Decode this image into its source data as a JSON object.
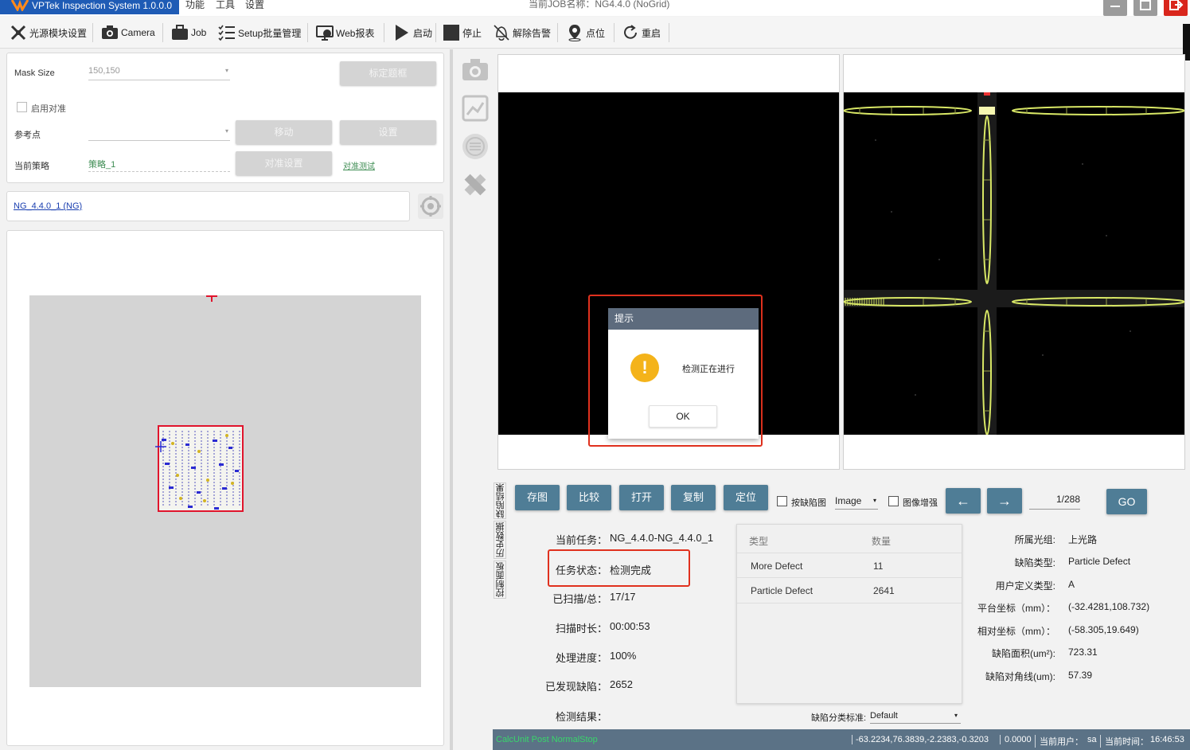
{
  "titlebar": {
    "app_title": "VPTek Inspection System 1.0.0.0",
    "menu": [
      "功能",
      "工具",
      "设置"
    ],
    "caption": "当前JOB名称：NG4.4.0 (NoGrid)"
  },
  "toolbar": {
    "items": [
      {
        "label": "光源模块设置",
        "icon": "light-module-icon"
      },
      {
        "label": "Camera",
        "icon": "camera-icon"
      },
      {
        "label": "Job",
        "icon": "briefcase-icon"
      },
      {
        "label": "Setup批量管理",
        "icon": "checklist-icon"
      },
      {
        "label": "Web报表",
        "icon": "monitor-icon"
      },
      {
        "label": "启动",
        "icon": "play-icon"
      },
      {
        "label": "停止",
        "icon": "stop-icon"
      },
      {
        "label": "解除告警",
        "icon": "bell-off-icon"
      },
      {
        "label": "点位",
        "icon": "location-pin-icon"
      },
      {
        "label": "重启",
        "icon": "restart-icon"
      }
    ]
  },
  "left_panel": {
    "mask_size_label": "Mask Size",
    "mask_size_value": "150,150",
    "calibrate_button": "标定题框",
    "enable_align_label": "启用对准",
    "ref_point_label": "参考点",
    "move_button": "移动",
    "set_button": "设置",
    "strategy_label": "当前策略",
    "strategy_value": "策略_1",
    "align_settings_button": "对准设置",
    "align_test_link": "对准测试",
    "job_link": "NG_4.4.0_1 (NG)"
  },
  "dialog": {
    "title": "提示",
    "message": "检测正在进行",
    "ok_label": "OK",
    "icon": "warning-icon"
  },
  "bottom_toolbar": {
    "save_image": "存图",
    "compare": "比较",
    "open": "打开",
    "copy": "复制",
    "locate": "定位",
    "by_defect_label": "按缺陷图",
    "image_select": "Image",
    "enhance_label": "图像增强",
    "prev_arrow": "←",
    "next_arrow": "→",
    "page": "1/288",
    "go_label": "GO"
  },
  "vertical_tabs": [
    "缺陷结果",
    "历史数据",
    "控制面板"
  ],
  "task_info": [
    {
      "label": "当前任务：",
      "value": "NG_4.4.0-NG_4.4.0_1"
    },
    {
      "label": "任务状态：",
      "value": "检测完成"
    },
    {
      "label": "已扫描/总：",
      "value": "17/17"
    },
    {
      "label": "扫描时长：",
      "value": "00:00:53"
    },
    {
      "label": "处理进度：",
      "value": "100%"
    },
    {
      "label": "已发现缺陷：",
      "value": "2652"
    },
    {
      "label": "检测结果：",
      "value": ""
    }
  ],
  "defect_table": {
    "headers": [
      "类型",
      "数量"
    ],
    "rows": [
      {
        "type": "More Defect",
        "count": "11"
      },
      {
        "type": "Particle Defect",
        "count": "2641"
      }
    ]
  },
  "classify_standard": {
    "label": "缺陷分类标准:",
    "value": "Default"
  },
  "defect_detail": [
    {
      "label": "所属光组:",
      "value": "上光路"
    },
    {
      "label": "缺陷类型:",
      "value": "Particle Defect"
    },
    {
      "label": "用户定义类型:",
      "value": "A"
    },
    {
      "label": "平台坐标（mm）：",
      "value": "(-32.4281,108.732)"
    },
    {
      "label": "相对坐标（mm）：",
      "value": "(-58.305,19.649)"
    },
    {
      "label": "缺陷面积(um²):",
      "value": "723.31"
    },
    {
      "label": "缺陷对角线(um):",
      "value": "57.39"
    }
  ],
  "status_bar": {
    "left_text": "CalcUnit Post NormalStop",
    "coords": "-63.2234,76.3839,-2.2383,-0.3203",
    "value": "0.0000",
    "user_label": "当前用户：",
    "user": "sa",
    "time_label": "当前时间：",
    "time": "16:46:53"
  },
  "colors": {
    "title_blue": "#1e5bb5",
    "teal_button": "#4f7d96",
    "status_bar": "#5b7286",
    "highlight_red": "#e0311e",
    "warning_orange": "#f4b31a",
    "wafer_line": "#d9e866"
  }
}
